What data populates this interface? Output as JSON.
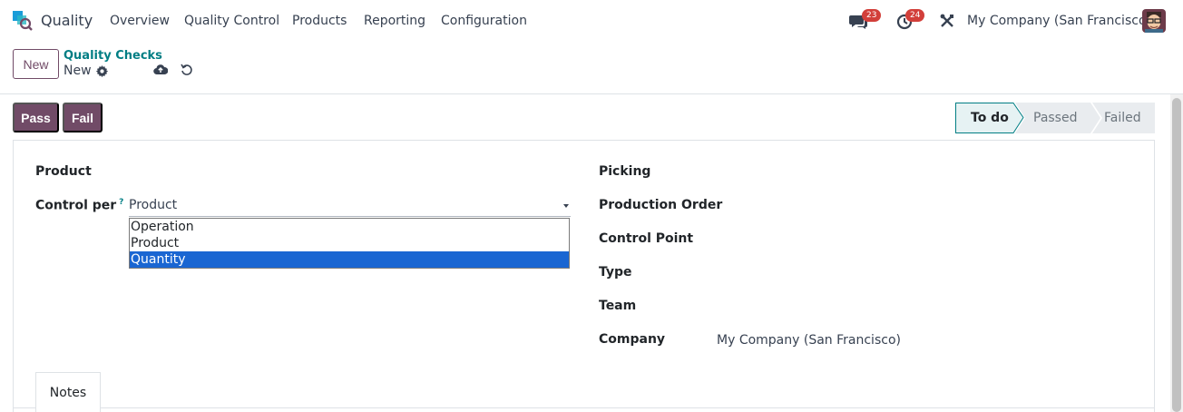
{
  "navbar": {
    "app_name": "Quality",
    "menu": [
      "Overview",
      "Quality Control",
      "Products",
      "Reporting",
      "Configuration"
    ],
    "messages_count": "23",
    "activities_count": "24",
    "company": "My Company (San Francisco)"
  },
  "control_panel": {
    "new_label": "New",
    "breadcrumb_parent": "Quality Checks",
    "breadcrumb_current": "New"
  },
  "status_bar": {
    "pass_label": "Pass",
    "fail_label": "Fail",
    "stages": [
      "To do",
      "Passed",
      "Failed"
    ],
    "active_stage": "To do"
  },
  "form": {
    "left": {
      "product_label": "Product",
      "control_per_label": "Control per",
      "control_per_help": "?",
      "control_per_value": "Product",
      "options": [
        "Operation",
        "Product",
        "Quantity"
      ],
      "highlighted_option": "Quantity"
    },
    "right": {
      "picking_label": "Picking",
      "production_order_label": "Production Order",
      "control_point_label": "Control Point",
      "type_label": "Type",
      "team_label": "Team",
      "company_label": "Company",
      "company_value": "My Company (San Francisco)"
    },
    "tabs": [
      "Notes"
    ]
  },
  "colors": {
    "primary": "#714b67",
    "link": "#017e84",
    "badge": "#d23f3a",
    "selection": "#1a66d2"
  }
}
